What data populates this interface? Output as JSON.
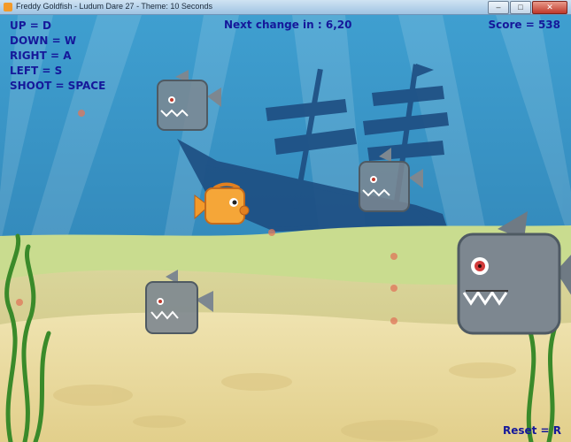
{
  "window": {
    "title": "Freddy Goldfish - Ludum Dare 27 - Theme: 10 Seconds",
    "minimize_icon": "minimize-icon",
    "maximize_icon": "maximize-icon",
    "close_icon": "close-icon"
  },
  "hud": {
    "controls": [
      "UP = D",
      "DOWN = W",
      "RIGHT = A",
      "LEFT = S",
      "SHOOT = SPACE"
    ],
    "next_change": "Next change in : 6,20",
    "score": "Score = 538",
    "reset": "Reset = R"
  },
  "colors": {
    "hud_text": "#15189a",
    "water_top": "#3f9fd0",
    "water_bottom": "#2a78aa",
    "sand": "#e5d59a",
    "seaweed": "#3a8a2a",
    "goldfish": "#f39a2a",
    "shark": "#7d8790"
  },
  "scene": {
    "player": "goldfish",
    "enemies": [
      "shark",
      "shark",
      "shark",
      "shark"
    ],
    "background": "sunken-pirate-ship"
  }
}
